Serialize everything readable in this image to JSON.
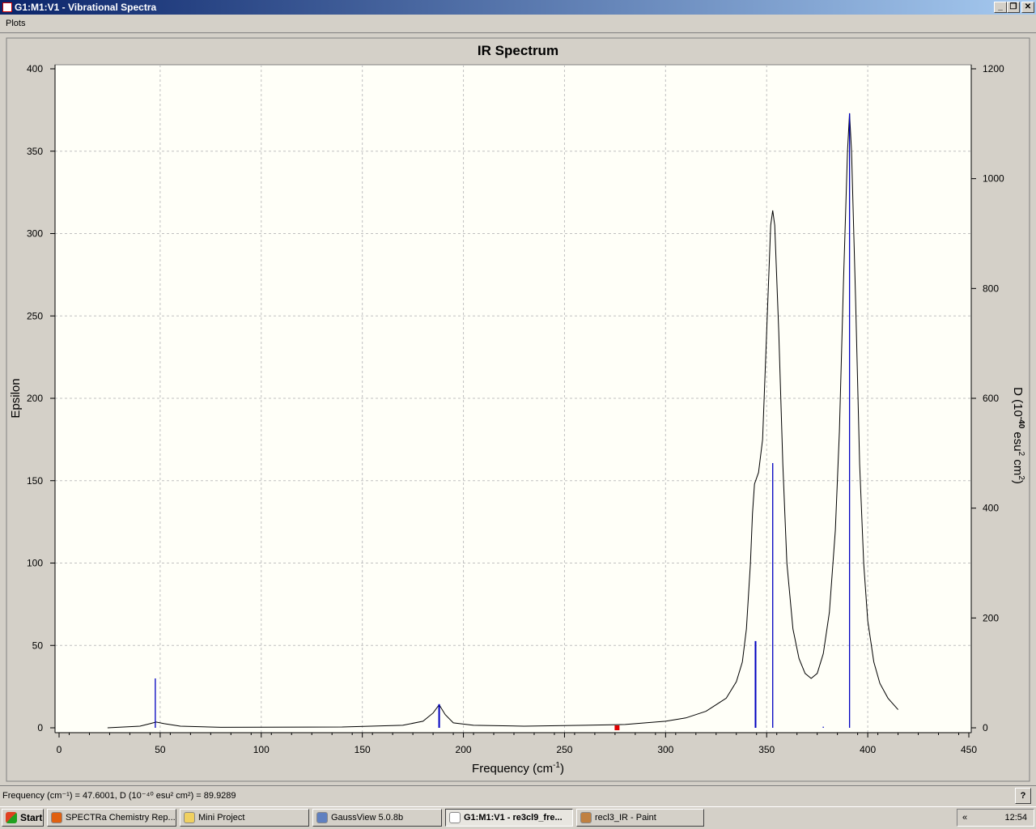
{
  "window": {
    "title": "G1:M1:V1 - Vibrational Spectra",
    "controls": [
      "minimize",
      "restore",
      "close"
    ]
  },
  "menu": {
    "items": [
      "Plots"
    ]
  },
  "status": {
    "text": "Frequency (cm⁻¹) = 47.6001, D (10⁻⁴⁰ esu² cm²) = 89.9289"
  },
  "taskbar": {
    "start": "Start",
    "items": [
      {
        "label": "SPECTRa Chemistry Rep...",
        "icon": "firefox-icon",
        "color": "#e06010"
      },
      {
        "label": "Mini Project",
        "icon": "folder-icon",
        "color": "#f0d060"
      },
      {
        "label": "GaussView 5.0.8b",
        "icon": "gaussview-icon",
        "color": "#6080c0"
      },
      {
        "label": "G1:M1:V1 - re3cl9_fre...",
        "icon": "document-icon",
        "color": "#ffffff",
        "active": true
      },
      {
        "label": "recl3_IR - Paint",
        "icon": "paint-icon",
        "color": "#c08040"
      }
    ],
    "clock": "12:54"
  },
  "chart_data": {
    "type": "line",
    "title": "IR Spectrum",
    "xlabel": "Frequency (cm",
    "xlabel_sup": "-1",
    "xlabel_end": ")",
    "ylabel": "Epsilon",
    "y2label": "D (10",
    "y2label_sup": "-40",
    "y2label_mid": " esu",
    "y2label_sup2": "2",
    "y2label_mid2": " cm",
    "y2label_sup3": "2",
    "y2label_end": ")",
    "xlim": [
      0,
      450
    ],
    "ylim": [
      0,
      400
    ],
    "y2lim": [
      0,
      1200
    ],
    "xticks": [
      0,
      50,
      100,
      150,
      200,
      250,
      300,
      350,
      400,
      450
    ],
    "yticks": [
      0,
      50,
      100,
      150,
      200,
      250,
      300,
      350,
      400
    ],
    "y2ticks": [
      0,
      200,
      400,
      600,
      800,
      1000,
      1200
    ],
    "grid": true,
    "colors": {
      "spectrum": "#000000",
      "sticks": "#0000c0",
      "marker": "#e00000",
      "plot_bg": "#fffff8"
    },
    "spectrum": {
      "x": [
        24,
        40,
        45,
        48,
        52,
        60,
        80,
        140,
        170,
        180,
        185,
        188,
        191,
        195,
        205,
        230,
        260,
        280,
        300,
        310,
        320,
        330,
        335,
        338,
        340,
        342,
        343,
        344,
        346,
        348,
        350,
        352,
        353,
        354,
        356,
        358,
        360,
        363,
        366,
        369,
        372,
        375,
        378,
        381,
        384,
        386,
        388,
        390,
        391,
        392,
        394,
        396,
        398,
        400,
        403,
        406,
        410,
        415
      ],
      "y": [
        0,
        1,
        2.5,
        3.5,
        2.5,
        1,
        0.3,
        0.5,
        1.5,
        4,
        9,
        14,
        8,
        3,
        1.5,
        1,
        1.5,
        2,
        4,
        6,
        10,
        18,
        28,
        40,
        60,
        100,
        130,
        148,
        155,
        175,
        240,
        305,
        314,
        305,
        240,
        160,
        100,
        60,
        42,
        33,
        30,
        33,
        45,
        70,
        120,
        180,
        270,
        350,
        373,
        350,
        260,
        160,
        100,
        65,
        40,
        27,
        18,
        11
      ]
    },
    "sticks": {
      "x": [
        47.6,
        188,
        344.5,
        353,
        378,
        391
      ],
      "D": [
        89.93,
        43,
        158,
        482,
        2,
        1119
      ]
    },
    "marker": {
      "x": 276
    }
  }
}
